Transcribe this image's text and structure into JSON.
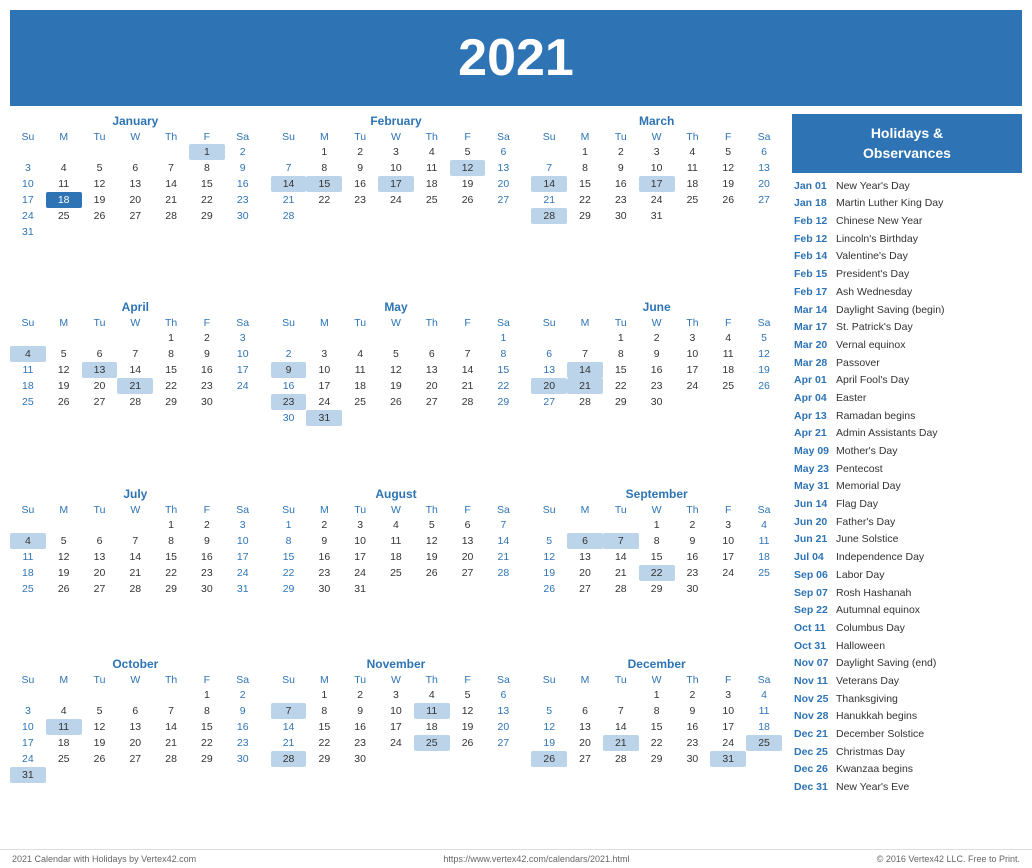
{
  "header": {
    "year": "2021"
  },
  "months": [
    {
      "name": "January",
      "days_in_month": 31,
      "first_day": 5,
      "weeks": [
        [
          "",
          "",
          "",
          "",
          "",
          "1",
          "2"
        ],
        [
          "3",
          "4",
          "5",
          "6",
          "7",
          "8",
          "9"
        ],
        [
          "10",
          "11",
          "12",
          "13",
          "14",
          "15",
          "16"
        ],
        [
          "17",
          "18",
          "19",
          "20",
          "21",
          "22",
          "23"
        ],
        [
          "24",
          "25",
          "26",
          "27",
          "28",
          "29",
          "30"
        ],
        [
          "31",
          "",
          "",
          "",
          "",
          "",
          ""
        ]
      ],
      "highlights": {
        "1": "holiday",
        "2": "weekend",
        "18": "today"
      }
    },
    {
      "name": "February",
      "days_in_month": 28,
      "first_day": 1,
      "weeks": [
        [
          "",
          "1",
          "2",
          "3",
          "4",
          "5",
          "6"
        ],
        [
          "7",
          "8",
          "9",
          "10",
          "11",
          "12",
          "13"
        ],
        [
          "14",
          "15",
          "16",
          "17",
          "18",
          "19",
          "20"
        ],
        [
          "21",
          "22",
          "23",
          "24",
          "25",
          "26",
          "27"
        ],
        [
          "28",
          "",
          "",
          "",
          "",
          "",
          ""
        ]
      ],
      "highlights": {
        "6": "weekend",
        "12": "holiday",
        "13": "weekend",
        "14": "holiday",
        "15": "holiday",
        "17": "holiday"
      }
    },
    {
      "name": "March",
      "days_in_month": 31,
      "first_day": 1,
      "weeks": [
        [
          "",
          "1",
          "2",
          "3",
          "4",
          "5",
          "6"
        ],
        [
          "7",
          "8",
          "9",
          "10",
          "11",
          "12",
          "13"
        ],
        [
          "14",
          "15",
          "16",
          "17",
          "18",
          "19",
          "20"
        ],
        [
          "21",
          "22",
          "23",
          "24",
          "25",
          "26",
          "27"
        ],
        [
          "28",
          "29",
          "30",
          "31",
          "",
          "",
          ""
        ]
      ],
      "highlights": {
        "6": "weekend",
        "13": "weekend",
        "14": "holiday",
        "17": "holiday",
        "20": "weekend",
        "27": "weekend",
        "28": "holiday"
      }
    },
    {
      "name": "April",
      "days_in_month": 30,
      "first_day": 4,
      "weeks": [
        [
          "",
          "",
          "",
          "",
          "1",
          "2",
          "3"
        ],
        [
          "4",
          "5",
          "6",
          "7",
          "8",
          "9",
          "10"
        ],
        [
          "11",
          "12",
          "13",
          "14",
          "15",
          "16",
          "17"
        ],
        [
          "18",
          "19",
          "20",
          "21",
          "22",
          "23",
          "24"
        ],
        [
          "25",
          "26",
          "27",
          "28",
          "29",
          "30",
          ""
        ]
      ],
      "highlights": {
        "3": "weekend",
        "4": "holiday",
        "10": "weekend",
        "13": "holiday",
        "17": "weekend",
        "21": "holiday",
        "24": "weekend"
      }
    },
    {
      "name": "May",
      "days_in_month": 31,
      "first_day": 6,
      "weeks": [
        [
          "",
          "",
          "",
          "",
          "",
          "",
          "1"
        ],
        [
          "2",
          "3",
          "4",
          "5",
          "6",
          "7",
          "8"
        ],
        [
          "9",
          "10",
          "11",
          "12",
          "13",
          "14",
          "15"
        ],
        [
          "16",
          "17",
          "18",
          "19",
          "20",
          "21",
          "22"
        ],
        [
          "23",
          "24",
          "25",
          "26",
          "27",
          "28",
          "29"
        ],
        [
          "30",
          "31",
          "",
          "",
          "",
          "",
          ""
        ]
      ],
      "highlights": {
        "1": "weekend",
        "8": "weekend",
        "9": "holiday",
        "15": "weekend",
        "22": "weekend",
        "23": "holiday",
        "29": "weekend",
        "31": "holiday"
      }
    },
    {
      "name": "June",
      "days_in_month": 30,
      "first_day": 2,
      "weeks": [
        [
          "",
          "",
          "1",
          "2",
          "3",
          "4",
          "5"
        ],
        [
          "6",
          "7",
          "8",
          "9",
          "10",
          "11",
          "12"
        ],
        [
          "13",
          "14",
          "15",
          "16",
          "17",
          "18",
          "19"
        ],
        [
          "20",
          "21",
          "22",
          "23",
          "24",
          "25",
          "26"
        ],
        [
          "27",
          "28",
          "29",
          "30",
          "",
          "",
          ""
        ]
      ],
      "highlights": {
        "5": "weekend",
        "12": "weekend",
        "14": "holiday",
        "19": "weekend",
        "20": "holiday",
        "21": "holiday",
        "26": "weekend"
      }
    },
    {
      "name": "July",
      "days_in_month": 31,
      "first_day": 4,
      "weeks": [
        [
          "",
          "",
          "",
          "",
          "1",
          "2",
          "3"
        ],
        [
          "4",
          "5",
          "6",
          "7",
          "8",
          "9",
          "10"
        ],
        [
          "11",
          "12",
          "13",
          "14",
          "15",
          "16",
          "17"
        ],
        [
          "18",
          "19",
          "20",
          "21",
          "22",
          "23",
          "24"
        ],
        [
          "25",
          "26",
          "27",
          "28",
          "29",
          "30",
          "31"
        ]
      ],
      "highlights": {
        "3": "weekend",
        "4": "holiday",
        "10": "weekend",
        "17": "weekend",
        "24": "weekend",
        "31": "weekend"
      }
    },
    {
      "name": "August",
      "days_in_month": 31,
      "first_day": 0,
      "weeks": [
        [
          "1",
          "2",
          "3",
          "4",
          "5",
          "6",
          "7"
        ],
        [
          "8",
          "9",
          "10",
          "11",
          "12",
          "13",
          "14"
        ],
        [
          "15",
          "16",
          "17",
          "18",
          "19",
          "20",
          "21"
        ],
        [
          "22",
          "23",
          "24",
          "25",
          "26",
          "27",
          "28"
        ],
        [
          "29",
          "30",
          "31",
          "",
          "",
          "",
          ""
        ]
      ],
      "highlights": {
        "7": "weekend",
        "14": "weekend",
        "21": "weekend",
        "28": "weekend"
      }
    },
    {
      "name": "September",
      "days_in_month": 30,
      "first_day": 3,
      "weeks": [
        [
          "",
          "",
          "",
          "1",
          "2",
          "3",
          "4"
        ],
        [
          "5",
          "6",
          "7",
          "8",
          "9",
          "10",
          "11"
        ],
        [
          "12",
          "13",
          "14",
          "15",
          "16",
          "17",
          "18"
        ],
        [
          "19",
          "20",
          "21",
          "22",
          "23",
          "24",
          "25"
        ],
        [
          "26",
          "27",
          "28",
          "29",
          "30",
          "",
          ""
        ]
      ],
      "highlights": {
        "4": "weekend",
        "6": "holiday",
        "7": "holiday",
        "11": "weekend",
        "18": "weekend",
        "22": "holiday",
        "25": "weekend"
      }
    },
    {
      "name": "October",
      "days_in_month": 31,
      "first_day": 5,
      "weeks": [
        [
          "",
          "",
          "",
          "",
          "",
          "1",
          "2"
        ],
        [
          "3",
          "4",
          "5",
          "6",
          "7",
          "8",
          "9"
        ],
        [
          "10",
          "11",
          "12",
          "13",
          "14",
          "15",
          "16"
        ],
        [
          "17",
          "18",
          "19",
          "20",
          "21",
          "22",
          "23"
        ],
        [
          "24",
          "25",
          "26",
          "27",
          "28",
          "29",
          "30"
        ],
        [
          "31",
          "",
          "",
          "",
          "",
          "",
          ""
        ]
      ],
      "highlights": {
        "2": "weekend",
        "9": "weekend",
        "11": "holiday",
        "16": "weekend",
        "23": "weekend",
        "30": "weekend",
        "31": "holiday"
      }
    },
    {
      "name": "November",
      "days_in_month": 30,
      "first_day": 1,
      "weeks": [
        [
          "",
          "1",
          "2",
          "3",
          "4",
          "5",
          "6"
        ],
        [
          "7",
          "8",
          "9",
          "10",
          "11",
          "12",
          "13"
        ],
        [
          "14",
          "15",
          "16",
          "17",
          "18",
          "19",
          "20"
        ],
        [
          "21",
          "22",
          "23",
          "24",
          "25",
          "26",
          "27"
        ],
        [
          "28",
          "29",
          "30",
          "",
          "",
          "",
          ""
        ]
      ],
      "highlights": {
        "6": "weekend",
        "7": "holiday",
        "11": "holiday",
        "13": "weekend",
        "20": "weekend",
        "25": "holiday",
        "27": "weekend",
        "28": "holiday"
      }
    },
    {
      "name": "December",
      "days_in_month": 31,
      "first_day": 3,
      "weeks": [
        [
          "",
          "",
          "",
          "1",
          "2",
          "3",
          "4"
        ],
        [
          "5",
          "6",
          "7",
          "8",
          "9",
          "10",
          "11"
        ],
        [
          "12",
          "13",
          "14",
          "15",
          "16",
          "17",
          "18"
        ],
        [
          "19",
          "20",
          "21",
          "22",
          "23",
          "24",
          "25"
        ],
        [
          "26",
          "27",
          "28",
          "29",
          "30",
          "31",
          ""
        ]
      ],
      "highlights": {
        "4": "weekend",
        "11": "weekend",
        "18": "weekend",
        "21": "holiday",
        "25": "holiday",
        "26": "holiday",
        "31": "holiday"
      }
    }
  ],
  "holidays_header": "Holidays &\nObservances",
  "holidays": [
    {
      "date": "Jan 01",
      "name": "New Year's Day"
    },
    {
      "date": "Jan 18",
      "name": "Martin Luther King Day"
    },
    {
      "date": "Feb 12",
      "name": "Chinese New Year"
    },
    {
      "date": "Feb 12",
      "name": "Lincoln's Birthday"
    },
    {
      "date": "Feb 14",
      "name": "Valentine's Day"
    },
    {
      "date": "Feb 15",
      "name": "President's Day"
    },
    {
      "date": "Feb 17",
      "name": "Ash Wednesday"
    },
    {
      "date": "Mar 14",
      "name": "Daylight Saving (begin)"
    },
    {
      "date": "Mar 17",
      "name": "St. Patrick's Day"
    },
    {
      "date": "Mar 20",
      "name": "Vernal equinox"
    },
    {
      "date": "Mar 28",
      "name": "Passover"
    },
    {
      "date": "Apr 01",
      "name": "April Fool's Day"
    },
    {
      "date": "Apr 04",
      "name": "Easter"
    },
    {
      "date": "Apr 13",
      "name": "Ramadan begins"
    },
    {
      "date": "Apr 21",
      "name": "Admin Assistants Day"
    },
    {
      "date": "May 09",
      "name": "Mother's Day"
    },
    {
      "date": "May 23",
      "name": "Pentecost"
    },
    {
      "date": "May 31",
      "name": "Memorial Day"
    },
    {
      "date": "Jun 14",
      "name": "Flag Day"
    },
    {
      "date": "Jun 20",
      "name": "Father's Day"
    },
    {
      "date": "Jun 21",
      "name": "June Solstice"
    },
    {
      "date": "Jul 04",
      "name": "Independence Day"
    },
    {
      "date": "Sep 06",
      "name": "Labor Day"
    },
    {
      "date": "Sep 07",
      "name": "Rosh Hashanah"
    },
    {
      "date": "Sep 22",
      "name": "Autumnal equinox"
    },
    {
      "date": "Oct 11",
      "name": "Columbus Day"
    },
    {
      "date": "Oct 31",
      "name": "Halloween"
    },
    {
      "date": "Nov 07",
      "name": "Daylight Saving (end)"
    },
    {
      "date": "Nov 11",
      "name": "Veterans Day"
    },
    {
      "date": "Nov 25",
      "name": "Thanksgiving"
    },
    {
      "date": "Nov 28",
      "name": "Hanukkah begins"
    },
    {
      "date": "Dec 21",
      "name": "December Solstice"
    },
    {
      "date": "Dec 25",
      "name": "Christmas Day"
    },
    {
      "date": "Dec 26",
      "name": "Kwanzaa begins"
    },
    {
      "date": "Dec 31",
      "name": "New Year's Eve"
    }
  ],
  "footer": {
    "left": "2021 Calendar with Holidays by Vertex42.com",
    "center": "https://www.vertex42.com/calendars/2021.html",
    "right": "© 2016 Vertex42 LLC. Free to Print."
  },
  "day_headers": [
    "Su",
    "M",
    "Tu",
    "W",
    "Th",
    "F",
    "Sa"
  ]
}
